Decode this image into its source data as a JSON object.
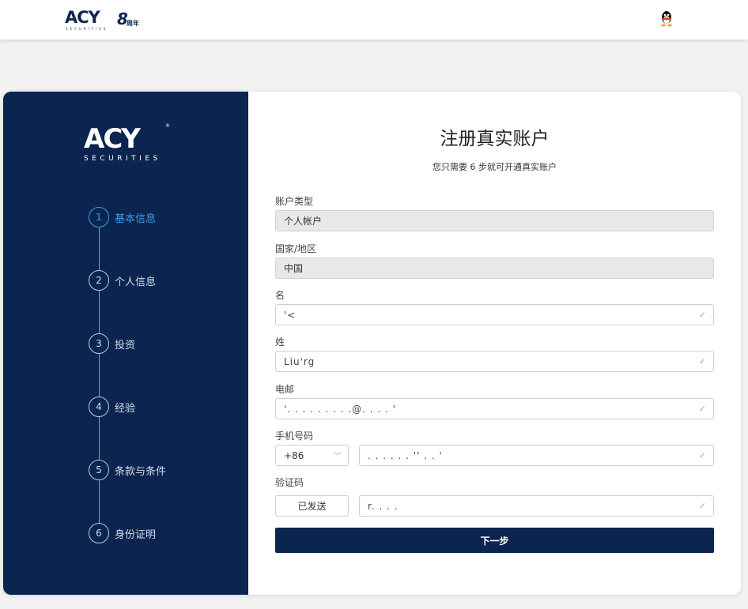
{
  "header": {
    "logo_text": "ACY",
    "logo_subtext": "SECURITIES",
    "anniversary_number": "8",
    "anniversary_text": "周年"
  },
  "sidebar": {
    "logo_text": "ACY",
    "logo_subtext": "SECURITIES",
    "steps": [
      {
        "num": "1",
        "label": "基本信息",
        "active": true
      },
      {
        "num": "2",
        "label": "个人信息",
        "active": false
      },
      {
        "num": "3",
        "label": "投资",
        "active": false
      },
      {
        "num": "4",
        "label": "经验",
        "active": false
      },
      {
        "num": "5",
        "label": "条款与条件",
        "active": false
      },
      {
        "num": "6",
        "label": "身份证明",
        "active": false
      }
    ]
  },
  "form": {
    "title": "注册真实账户",
    "subtitle": "您只需要 6 步就可开通真实账户",
    "account_type": {
      "label": "账户类型",
      "value": "个人帐户"
    },
    "country": {
      "label": "国家/地区",
      "value": "中国"
    },
    "first_name": {
      "label": "名",
      "value": "'<"
    },
    "last_name": {
      "label": "姓",
      "value": "Liu'rg"
    },
    "email": {
      "label": "电邮",
      "value": "'. . . . . . . . .@. . . . '"
    },
    "phone": {
      "label": "手机号码",
      "country_code": "+86",
      "value": ". . . . . . '' . . '"
    },
    "verification": {
      "label": "验证码",
      "send_button": "已发送",
      "value": "r. . . ."
    },
    "next_button": "下一步"
  },
  "colors": {
    "brand_navy": "#0b2550",
    "active_step": "#3f9be6",
    "check": "#7fb7e0"
  }
}
